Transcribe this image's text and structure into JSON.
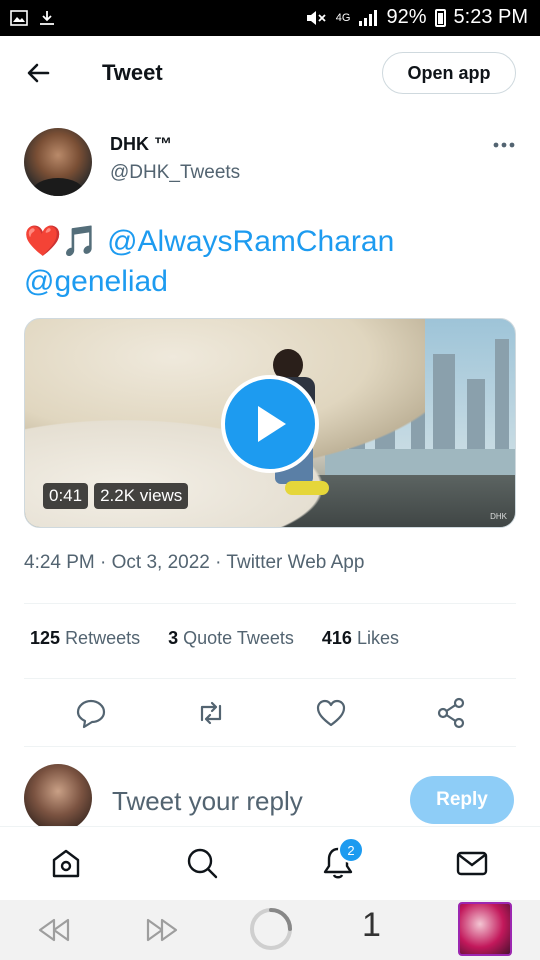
{
  "status_bar": {
    "network": "4G",
    "battery": "92%",
    "time": "5:23 PM"
  },
  "header": {
    "title": "Tweet",
    "open_app_label": "Open app"
  },
  "author": {
    "name": "DHK ™",
    "handle": "@DHK_Tweets"
  },
  "tweet": {
    "emoji_heart": "❤️",
    "emoji_note": "🎵",
    "mention1": "@AlwaysRamCharan",
    "mention2": "@geneliad",
    "video": {
      "duration": "0:41",
      "views": "2.2K views",
      "watermark": "DHK"
    },
    "timestamp": "4:24 PM · Oct 3, 2022 · Twitter Web App"
  },
  "stats": {
    "retweets_count": "125",
    "retweets_label": "Retweets",
    "quotes_count": "3",
    "quotes_label": "Quote Tweets",
    "likes_count": "416",
    "likes_label": "Likes"
  },
  "reply": {
    "placeholder": "Tweet your reply",
    "button_label": "Reply"
  },
  "tabbar": {
    "notification_count": "2"
  },
  "browser_nav": {
    "tab_count": "1"
  },
  "colors": {
    "accent": "#1d9bf0",
    "reply_button_disabled": "#8ecdf7",
    "secondary_text": "#536471"
  }
}
